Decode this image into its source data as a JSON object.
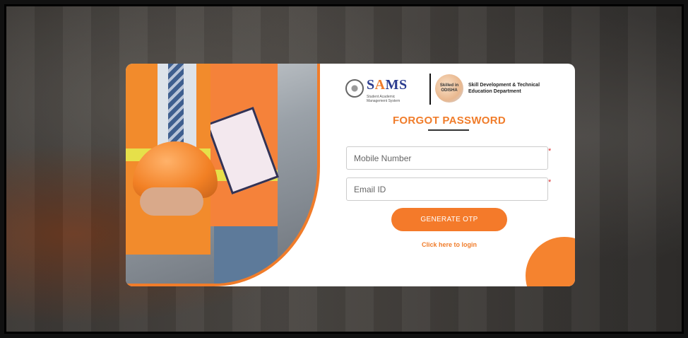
{
  "header": {
    "brand_prefix": "S",
    "brand_accent": "A",
    "brand_suffix": "MS",
    "brand_subtitle": "Student Academic Management System",
    "logo_line1": "Skilled in",
    "logo_line2": "ODISHA",
    "department": "Skill Development & Technical Education Department"
  },
  "form": {
    "title": "FORGOT PASSWORD",
    "mobile_placeholder": "Mobile Number",
    "email_placeholder": "Email ID",
    "required_mark": "*",
    "submit_label": "GENERATE OTP",
    "login_link": "Click here to login"
  },
  "colors": {
    "accent": "#f07c2a",
    "brand_blue": "#2b3c8f",
    "required": "#dd3333"
  },
  "icons": {
    "emblem": "state-emblem-icon",
    "odisha": "skilled-in-odisha-logo"
  }
}
